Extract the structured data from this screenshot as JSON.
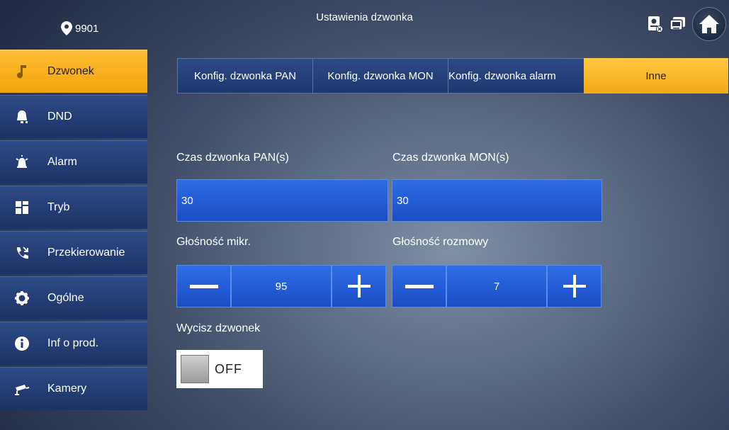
{
  "header": {
    "room_number": "9901",
    "title": "Ustawienia dzwonka",
    "icons": [
      "location-pin-icon",
      "intercom-icon",
      "monitor-icon",
      "home-icon"
    ]
  },
  "sidebar": {
    "items": [
      {
        "label": "Dzwonek",
        "icon": "music-note-icon",
        "active": true
      },
      {
        "label": "DND",
        "icon": "bell-icon",
        "active": false
      },
      {
        "label": "Alarm",
        "icon": "alarm-siren-icon",
        "active": false
      },
      {
        "label": "Tryb",
        "icon": "grid-icon",
        "active": false
      },
      {
        "label": "Przekierowanie",
        "icon": "call-forward-icon",
        "active": false
      },
      {
        "label": "Ogólne",
        "icon": "gear-icon",
        "active": false
      },
      {
        "label": "Inf o prod.",
        "icon": "info-icon",
        "active": false
      },
      {
        "label": "Kamery",
        "icon": "camera-icon",
        "active": false
      }
    ]
  },
  "tabs": [
    {
      "label": "Konfig. dzwonka PAN",
      "active": false
    },
    {
      "label": "Konfig. dzwonka MON",
      "active": false
    },
    {
      "label": "Konfig. dzwonka alarm",
      "active": false
    },
    {
      "label": "Inne",
      "active": true
    }
  ],
  "form": {
    "pan_ring_time_label": "Czas dzwonka PAN(s)",
    "pan_ring_time_value": "30",
    "mon_ring_time_label": "Czas dzwonka MON(s)",
    "mon_ring_time_value": "30",
    "mic_volume_label": "Głośność mikr.",
    "mic_volume_value": "95",
    "talk_volume_label": "Głośność rozmowy",
    "talk_volume_value": "7",
    "mute_ring_label": "Wycisz dzwonek",
    "mute_ring_state": "OFF"
  },
  "colors": {
    "accent": "#f5ad1c",
    "field_blue": "#1f55d0",
    "sidebar_blue": "#233a72"
  }
}
